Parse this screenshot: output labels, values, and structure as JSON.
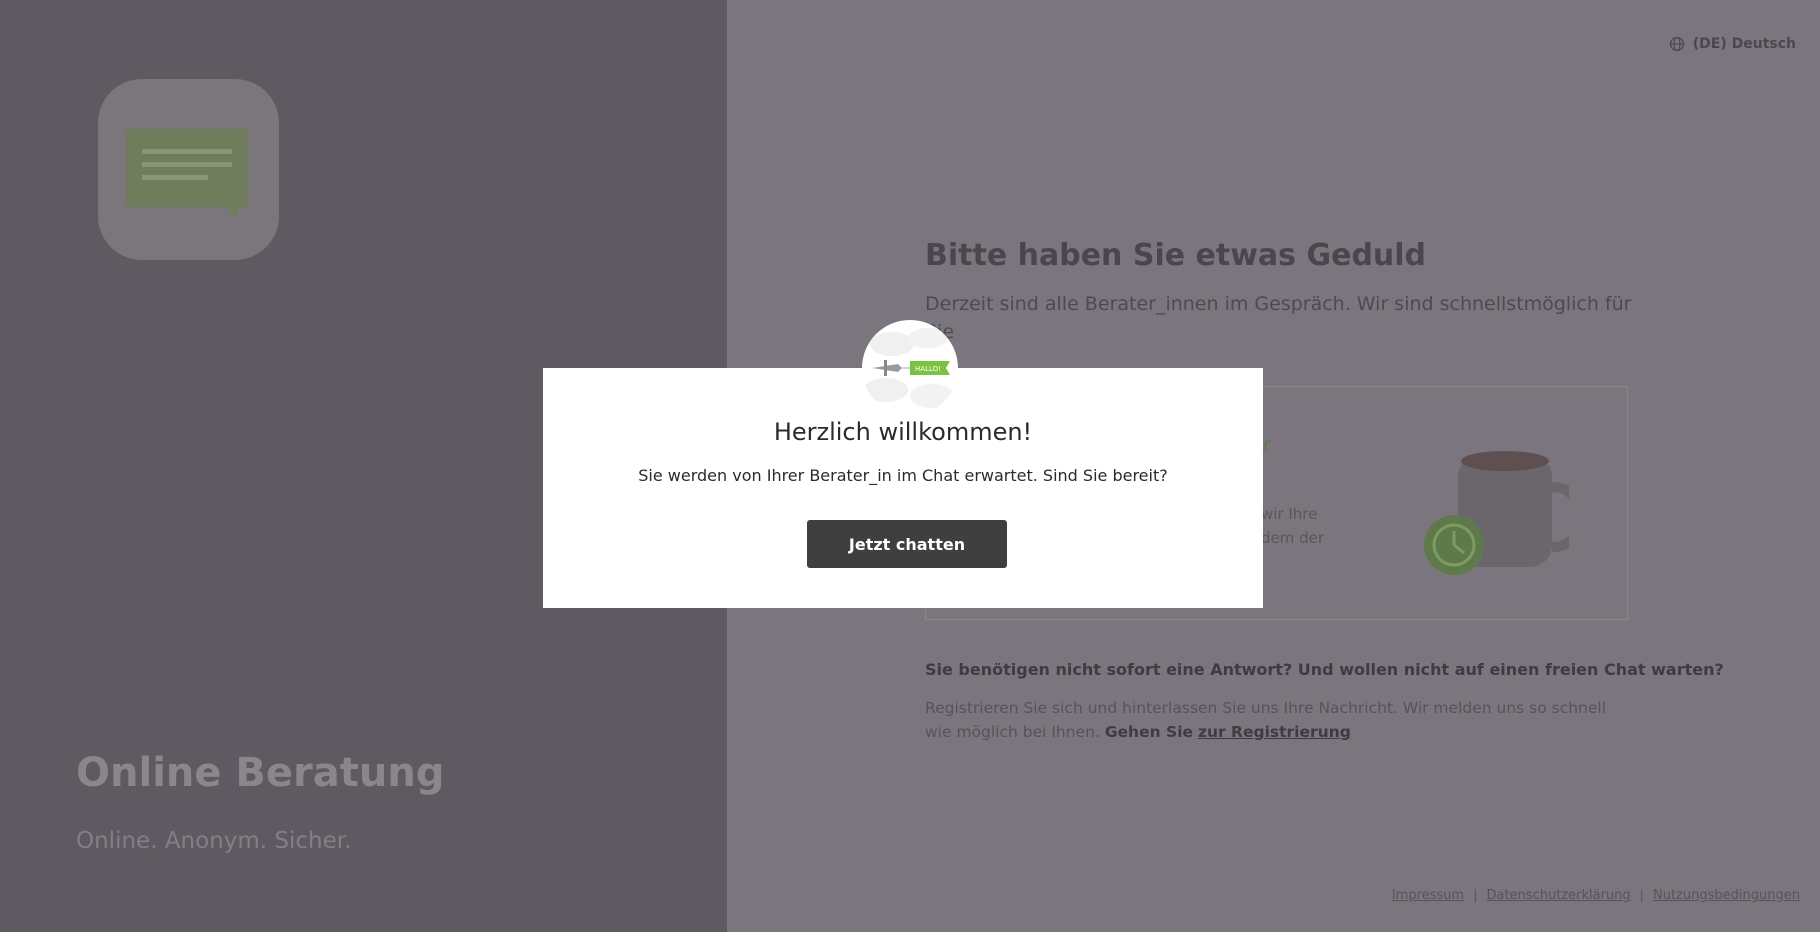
{
  "brand": {
    "title": "Online Beratung",
    "tagline": "Online. Anonym. Sicher."
  },
  "header": {
    "language": "(DE) Deutsch",
    "language_icon": "globe-icon"
  },
  "waiting": {
    "title": "Bitte haben Sie etwas Geduld",
    "subtitle": "Derzeit sind alle Berater_innen im Gespräch. Wir sind schnellstmöglich für Sie",
    "card_heading": "ende_r",
    "card_text_line1": "wir Ihre",
    "card_text_line2": "dem der"
  },
  "register": {
    "question": "Sie benötigen nicht sofort eine Antwort? Und wollen nicht auf einen freien Chat warten?",
    "text": "Registrieren Sie sich und hinterlassen Sie uns Ihre Nachricht. Wir melden uns so schnell wie möglich bei Ihnen.",
    "go_label": "Gehen Sie",
    "link_label": "zur Registrierung"
  },
  "footer": {
    "links": [
      "Impressum",
      "Datenschutzerklärung",
      "Nutzungsbedingungen"
    ],
    "separator": "|"
  },
  "modal": {
    "banner_text": "HALLO!",
    "title": "Herzlich willkommen!",
    "text": "Sie werden von Ihrer Berater_in im Chat erwartet. Sind Sie bereit?",
    "button_label": "Jetzt chatten"
  },
  "colors": {
    "overlay_left": "#5f5a61",
    "overlay_right": "#7b767e",
    "button": "#3f3f3f",
    "accent_green": "#7cc242"
  }
}
